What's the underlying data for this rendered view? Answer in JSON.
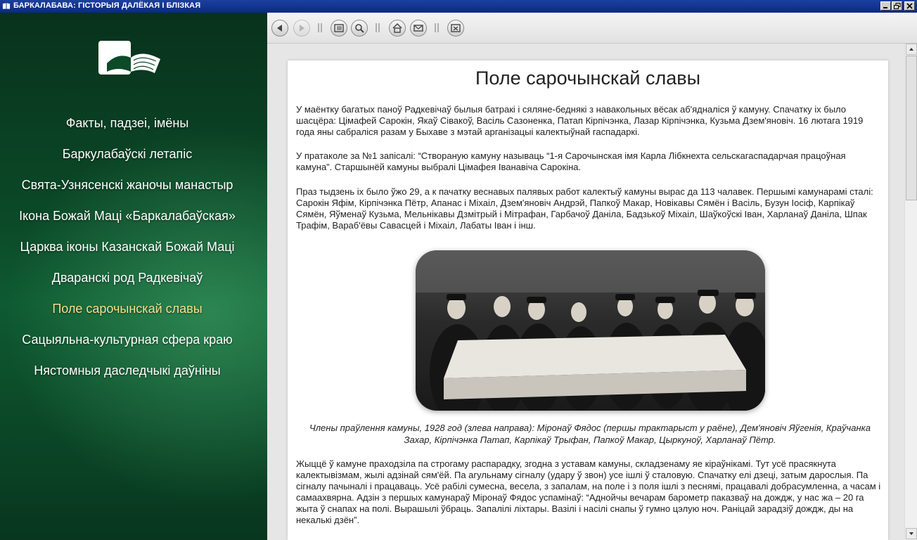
{
  "window": {
    "title": "БАРКАЛАБАВА: ГІСТОРЫЯ ДАЛЁКАЯ І БЛІЗКАЯ",
    "controls": [
      "minimize-icon",
      "restore-icon",
      "close-icon"
    ]
  },
  "sidebar": {
    "logo_icon": "open-book-icon",
    "items": [
      {
        "label": "Факты, падзеі, імёны",
        "active": false
      },
      {
        "label": "Баркулабаўскі летапіс",
        "active": false
      },
      {
        "label": "Свята-Узнясенскі жаночы манастыр",
        "active": false
      },
      {
        "label": "Ікона Божай Маці «Баркалабаўская»",
        "active": false
      },
      {
        "label": "Царква іконы Казанскай Божай Маці",
        "active": false
      },
      {
        "label": "Дваранскі род Радкевічаў",
        "active": false
      },
      {
        "label": "Поле сарочынскай славы",
        "active": true
      },
      {
        "label": "Сацыяльна-культурная сфера краю",
        "active": false
      },
      {
        "label": "Нястомныя даследчыкі даўніны",
        "active": false
      }
    ]
  },
  "toolbar": {
    "buttons": [
      "back-icon",
      "forward-icon",
      "contents-icon",
      "search-icon",
      "home-icon",
      "mail-icon",
      "exit-icon"
    ]
  },
  "colors": {
    "sidebar_green": "#0b4a28",
    "active_item": "#f5e08a",
    "titlebar_blue": "#0a2a85"
  },
  "article": {
    "title": "Поле сарочынскай славы",
    "paragraphs": [
      "У маёнтку багатых паноў Радкевічаў былыя батракі і сяляне-беднякі з навакольных вёсак аб'ядналіся ў камуну. Спачатку іх было шасцёра: Цімафей Сарокін, Якаў Сівакоў, Васіль Сазоненка, Патап Кірпічэнка, Лазар Кірпічэнка, Кузьма Дзем'яновіч. 16 лютага 1919 года яны сабраліся разам у Быхаве з мэтай арганізацыі калектыўнай гаспадаркі.",
      "У пратаколе за №1 запісалі: “Створаную камуну называць “1-я Сарочынская імя Карла Лібкнехта сельскагаспадарчая працоўная камуна”. Старшынёй камуны выбралі Цімафея Іванавіча Сарокіна.",
      "Праз тыдзень іх было ўжо 29, а к пачатку веснавых палявых работ калектыў камуны вырас да 113 чалавек. Першымі камунарамі сталі: Сарокін Яфім, Кірпічэнка Пётр, Апанас і Міхаіл, Дзем'яновіч Андрэй, Папкоў Макар, Новікавы Сямён і Васіль, Бузун Іосіф, Карпікаў Сямён, Яўменаў Кузьма, Мельнікавы Дзмітрый і Мітрафан, Гарбачоў Даніла, Бадзькоў Міхаіл, Шаўкоўскі Іван, Харланаў Даніла, Шпак Трафім, Вараб'ёвы Савасцей і Міхаіл, Лабаты Іван і інш.",
      "Жыццё ў камуне праходзіла па строгаму распарадку, згодна з уставам камуны, складзенаму яе кіраўнікамі. Тут усё прасякнута калектывізмам, жылі адзінай сям'ёй. Па агульнаму сігналу (удару ў звон) усе ішлі ў сталовую. Спачатку елі дзеці, затым дарослыя. Па сігналу пачыналі і працаваць. Усё рабілі сумесна, весела, з запалам, на поле і з поля ішлі з песнямі, працавалі добрасумленна, а часам і самаахвярна. Адзін з першых камунараў Міронаў Фядос успамінаў: “Аднойчы вечарам барометр паказваў на дождж, у нас жа – 20 га жыта ў снапах на полі. Вырашылі ўбраць. Запалілі ліхтары. Вазілі і насілі снапы ў гумно цэлую ноч. Раніцай зарадзіў дождж, ды на некалькі дзён”."
    ],
    "photo_caption": "Члены праўлення камуны, 1928 год (злева направа): Міронаў Фядос (першы трактарыст у раёне), Дем'яновіч Яўгенія, Краўчанка Захар, Кірпічэнка Патап, Карпікаў Трыфан, Папкоў Макар, Цыркуноў, Харланаў Пётр."
  }
}
